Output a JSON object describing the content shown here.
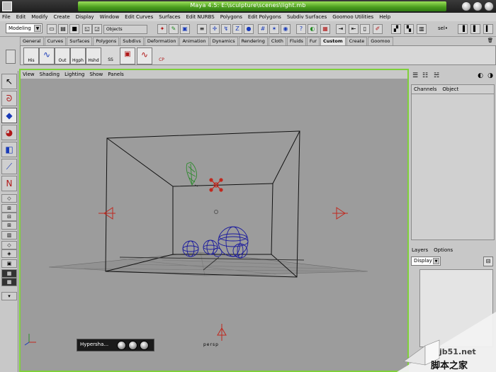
{
  "window": {
    "title": "Maya 4.5: E:\\sculpture\\scenes\\light.mb"
  },
  "menubar": [
    "File",
    "Edit",
    "Modify",
    "Create",
    "Display",
    "Window",
    "Edit Curves",
    "Surfaces",
    "Edit NURBS",
    "Polygons",
    "Edit Polygons",
    "Subdiv Surfaces",
    "Goomoo Utilities",
    "Help"
  ],
  "statusline": {
    "mode": "Modeling",
    "object_field": "Objects",
    "sel_label": "sel•"
  },
  "shelf": {
    "tabs": [
      "General",
      "Curves",
      "Surfaces",
      "Polygons",
      "Subdivs",
      "Deformation",
      "Animation",
      "Dynamics",
      "Rendering",
      "Cloth",
      "Fluids",
      "Fur",
      "Custom",
      "Create",
      "Goomoo"
    ],
    "active_tab": "Custom",
    "buttons": [
      "His",
      "",
      "Out",
      "Hgph",
      "Hshd",
      "SS",
      "",
      "",
      "CP"
    ]
  },
  "viewport": {
    "menu": [
      "View",
      "Shading",
      "Lighting",
      "Show",
      "Panels"
    ],
    "camera_label": "persp"
  },
  "channelbox": {
    "headers": [
      "Channels",
      "Object"
    ]
  },
  "layers": {
    "headers": [
      "Layers",
      "Options"
    ],
    "display_value": "Display"
  },
  "taskbar": {
    "label": "Hypersha..."
  },
  "watermark": {
    "line1": "jb51.net",
    "line2": "脚本之家"
  },
  "colors": {
    "accent_green": "#7fd03a",
    "wire_blue": "#1a1a9e",
    "light_red": "#c0281e",
    "sculpture_green": "#2e8a2e"
  }
}
